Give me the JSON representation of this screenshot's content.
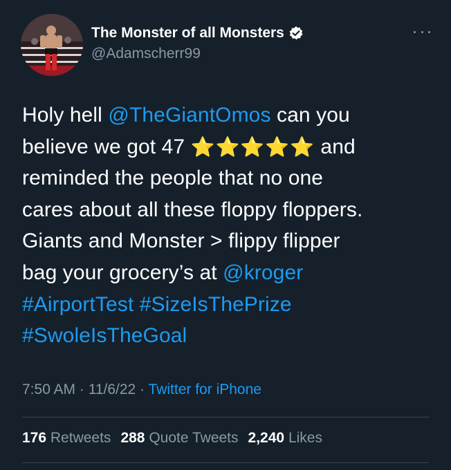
{
  "author": {
    "display_name": "The Monster of all Monsters",
    "handle": "@Adamscherr99",
    "verified": true,
    "avatar": "wrestler-in-ring-photo"
  },
  "more_icon": "ellipsis-icon",
  "tweet": {
    "lines": [
      [
        {
          "t": "Holy hell "
        },
        {
          "t": "@TheGiantOmos",
          "link": true
        },
        {
          "t": " can you"
        }
      ],
      [
        {
          "t": "believe we got 47 "
        },
        {
          "t": "⭐⭐⭐⭐⭐",
          "stars": true
        },
        {
          "t": " and"
        }
      ],
      [
        {
          "t": "reminded the people that no one"
        }
      ],
      [
        {
          "t": "cares about all these floppy floppers."
        }
      ],
      [
        {
          "t": "Giants and Monster > flippy flipper"
        }
      ],
      [
        {
          "t": "bag your grocery’s at "
        },
        {
          "t": "@kroger",
          "link": true
        }
      ],
      [
        {
          "t": "#AirportTest",
          "link": true
        },
        {
          "t": " "
        },
        {
          "t": "#SizeIsThePrize",
          "link": true
        }
      ],
      [
        {
          "t": "#SwoleIsTheGoal",
          "link": true
        }
      ]
    ]
  },
  "meta": {
    "time": "7:50 AM",
    "sep1": " · ",
    "date": "11/6/22",
    "sep2": " · ",
    "source": "Twitter for iPhone"
  },
  "stats": {
    "retweets_count": "176",
    "retweets_label": "Retweets",
    "quotes_count": "288",
    "quotes_label": "Quote Tweets",
    "likes_count": "2,240",
    "likes_label": "Likes"
  },
  "colors": {
    "background": "#15202b",
    "link": "#1d9bf0",
    "muted": "#8b98a5",
    "divider": "#38444d"
  }
}
